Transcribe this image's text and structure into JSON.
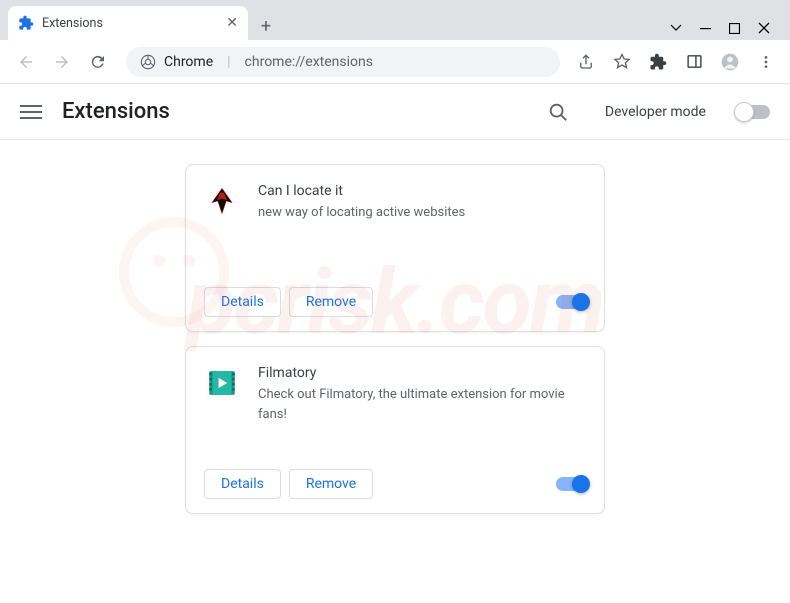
{
  "window": {
    "tab_title": "Extensions"
  },
  "toolbar": {
    "origin_label": "Chrome",
    "url": "chrome://extensions"
  },
  "header": {
    "title": "Extensions",
    "dev_mode_label": "Developer mode",
    "dev_mode_on": false
  },
  "buttons": {
    "details": "Details",
    "remove": "Remove"
  },
  "extensions": [
    {
      "name": "Can I locate it",
      "description": "new way of locating active websites",
      "enabled": true,
      "icon": "wings"
    },
    {
      "name": "Filmatory",
      "description": "Check out Filmatory, the ultimate extension for movie fans!",
      "enabled": true,
      "icon": "film"
    }
  ],
  "watermark": "pcrisk.com"
}
